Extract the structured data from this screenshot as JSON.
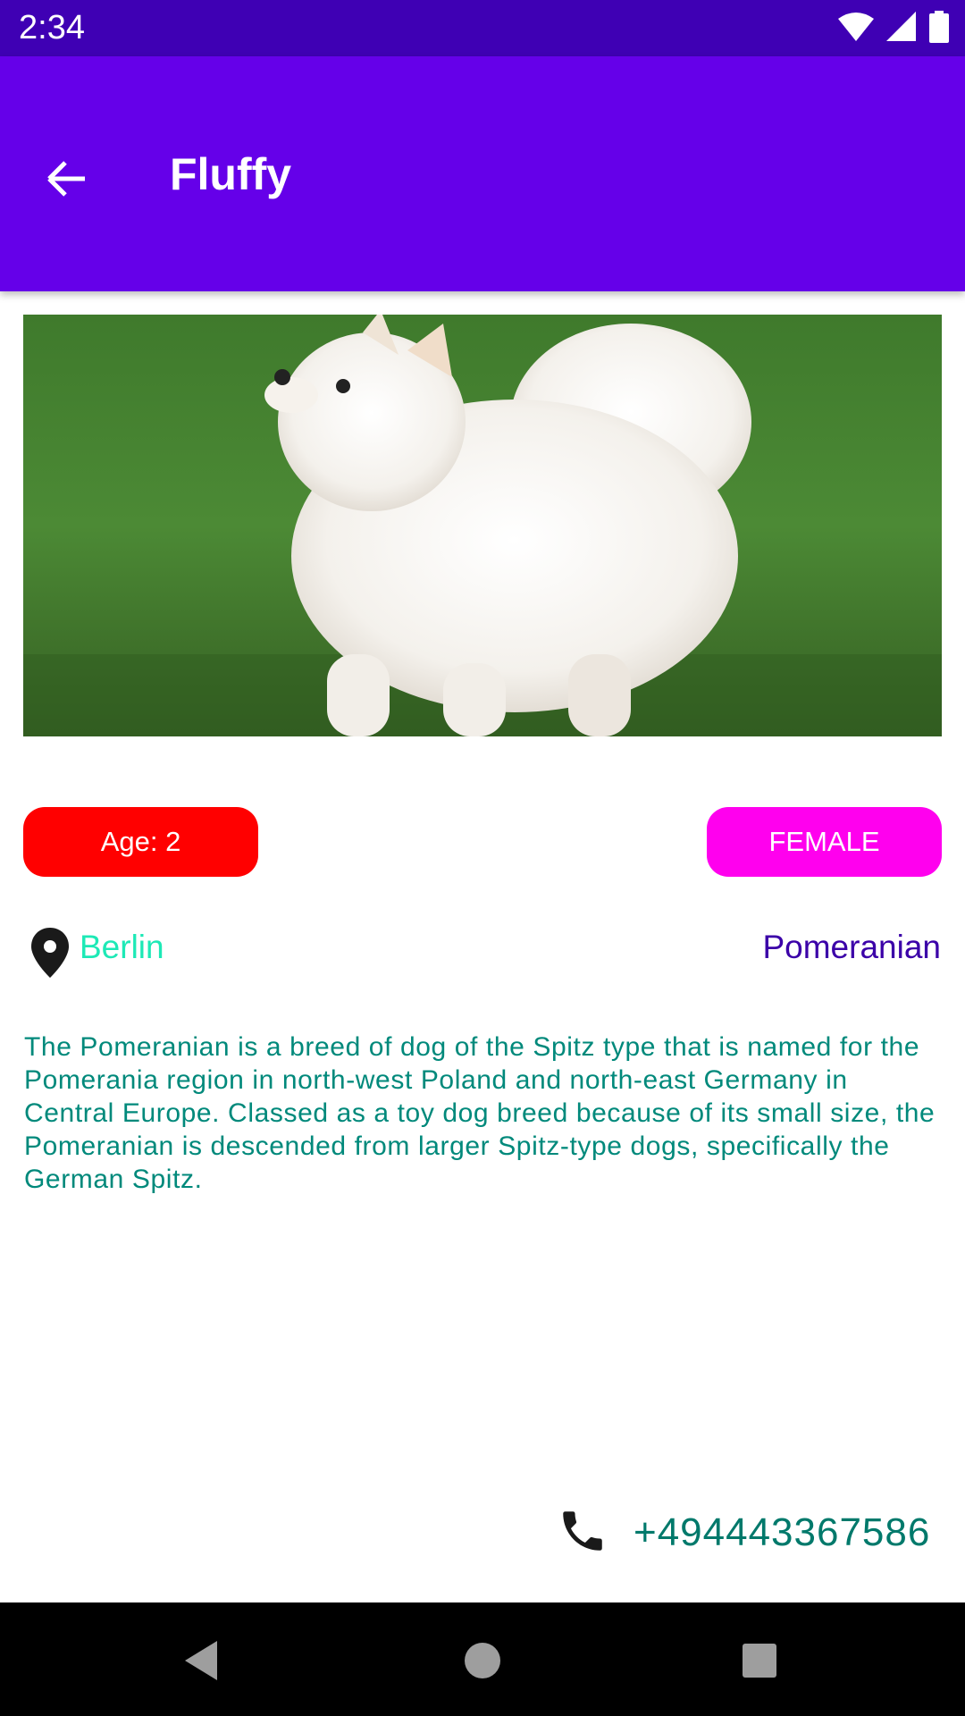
{
  "status_bar": {
    "time": "2:34",
    "icons": [
      "wifi-icon",
      "signal-icon",
      "battery-icon"
    ]
  },
  "app_bar": {
    "back_icon": "arrow-back-icon",
    "title": "Fluffy"
  },
  "pet": {
    "photo_icon": "dog-photo",
    "age_label": "Age: 2",
    "gender_label": "FEMALE",
    "location_icon": "location-pin-icon",
    "location": "Berlin",
    "breed": "Pomeranian",
    "description": "The Pomeranian is a breed of dog of the Spitz type that is named for the Pomerania region in north-west Poland and north-east Germany in Central Europe. Classed as a toy dog breed because of its small size, the Pomeranian is descended from larger Spitz-type dogs, specifically the German Spitz.",
    "phone_icon": "phone-icon",
    "phone": "+494443367586"
  },
  "nav_bar": {
    "icons": [
      "back-triangle-icon",
      "home-circle-icon",
      "recents-square-icon"
    ]
  },
  "colors": {
    "status_bar": "#3f00b4",
    "app_bar": "#6500e9",
    "age_chip": "#ff0000",
    "gender_chip": "#ff00ee",
    "location_text": "#1de9b6",
    "breed_text": "#3b00a8",
    "description_text": "#00897b",
    "phone_text": "#00796b"
  }
}
